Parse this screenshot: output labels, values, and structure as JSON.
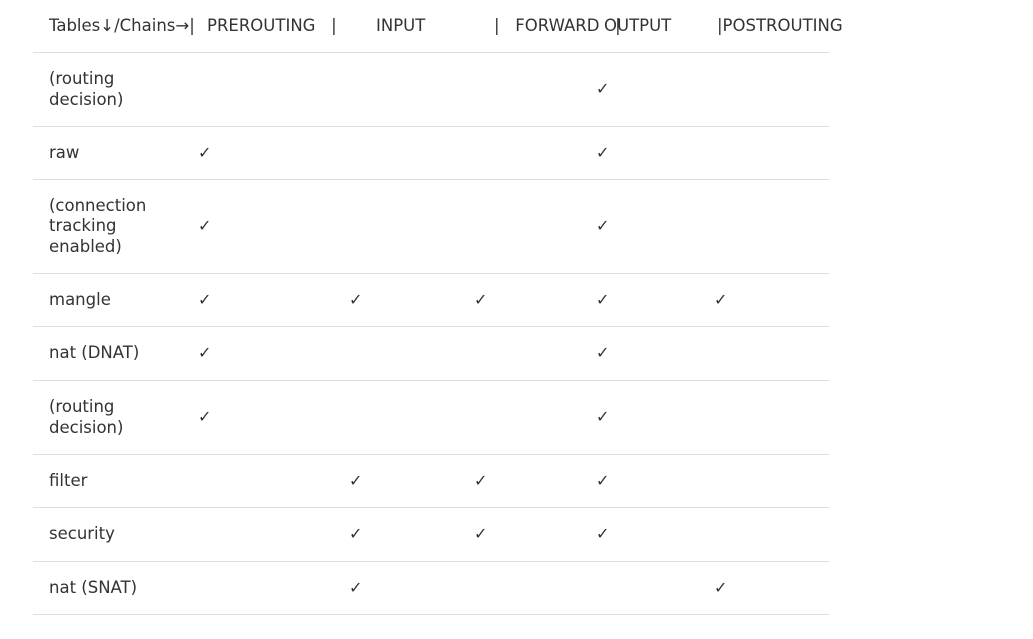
{
  "table": {
    "headers": [
      "Tables↓/Chains→|",
      "PREROUTING   |",
      "INPUT",
      "|   FORWARD   |",
      "OUTPUT",
      "|POSTROUTING"
    ],
    "check_mark": "✓",
    "rows": [
      {
        "label": "(routing decision)",
        "cells": [
          "",
          "",
          "",
          "✓",
          ""
        ]
      },
      {
        "label": "raw",
        "cells": [
          "✓",
          "",
          "",
          "✓",
          ""
        ]
      },
      {
        "label": "(connection tracking enabled)",
        "cells": [
          "✓",
          "",
          "",
          "✓",
          ""
        ]
      },
      {
        "label": "mangle",
        "cells": [
          "✓",
          "✓",
          "✓",
          "✓",
          "✓"
        ]
      },
      {
        "label": "nat (DNAT)",
        "cells": [
          "✓",
          "",
          "",
          "✓",
          ""
        ]
      },
      {
        "label": "(routing decision)",
        "cells": [
          "✓",
          "",
          "",
          "✓",
          ""
        ]
      },
      {
        "label": "filter",
        "cells": [
          "",
          "✓",
          "✓",
          "✓",
          ""
        ]
      },
      {
        "label": "security",
        "cells": [
          "",
          "✓",
          "✓",
          "✓",
          ""
        ]
      },
      {
        "label": "nat (SNAT)",
        "cells": [
          "",
          "✓",
          "",
          "",
          "✓"
        ]
      }
    ]
  }
}
